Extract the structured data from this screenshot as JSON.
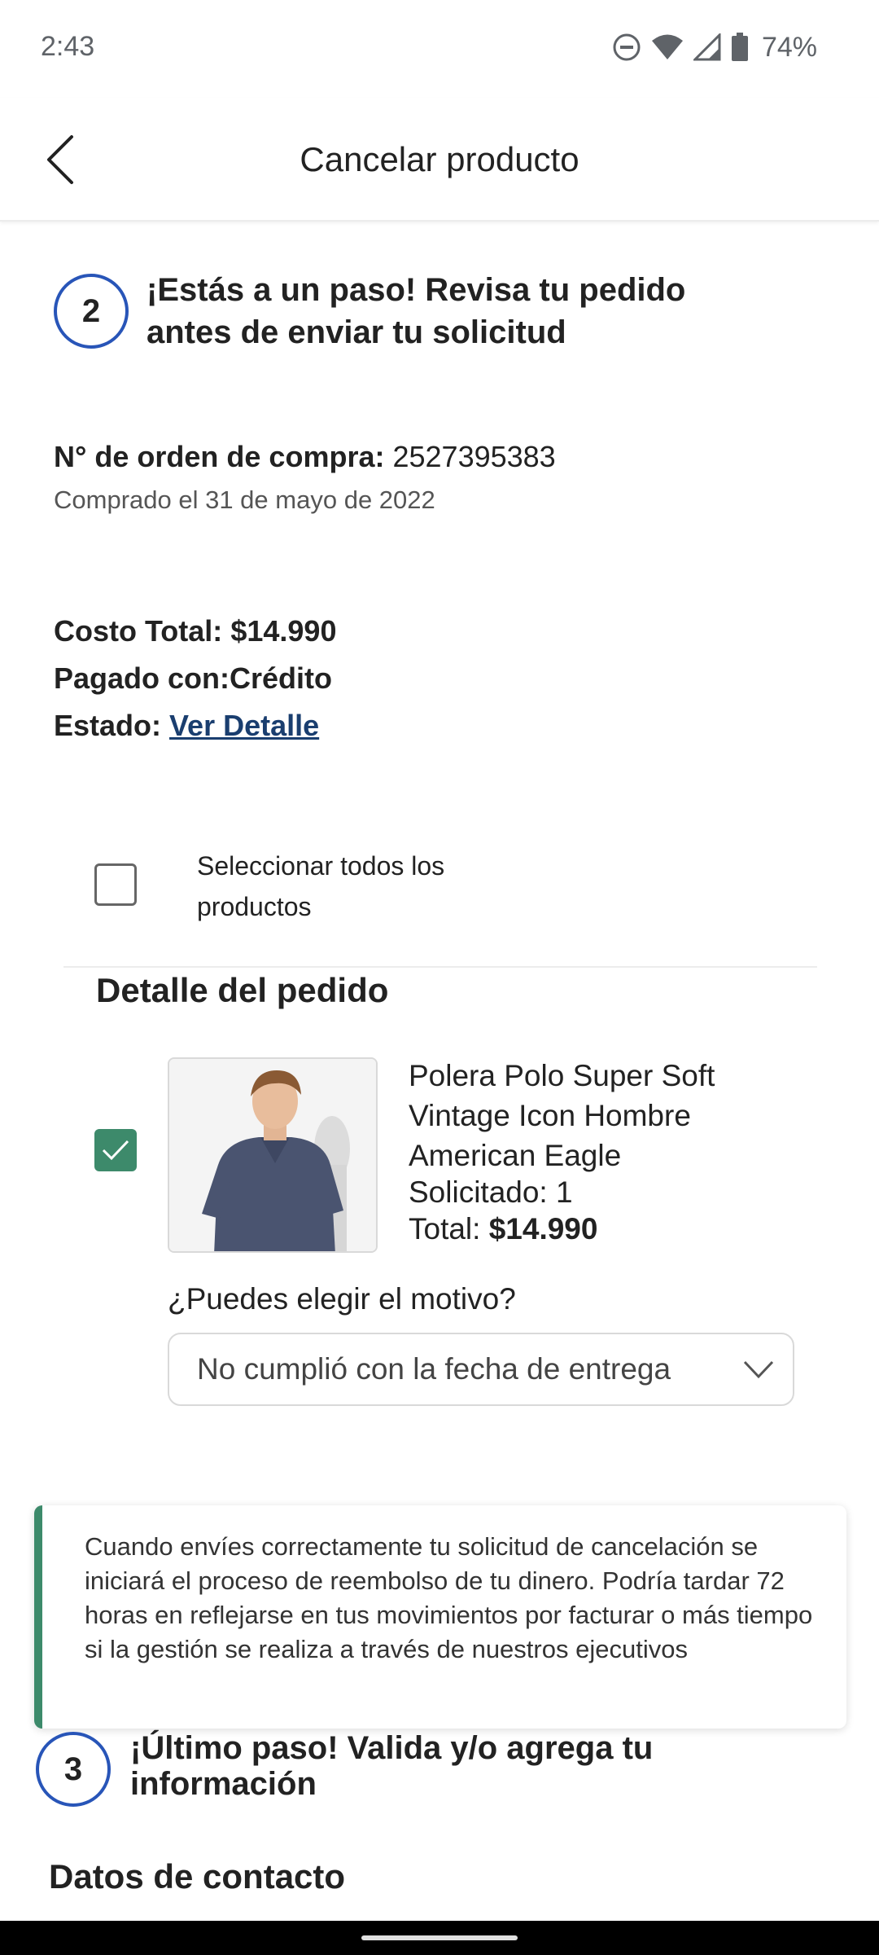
{
  "status_bar": {
    "time": "2:43",
    "battery_percent": "74%",
    "icons": [
      "do-not-disturb-icon",
      "wifi-icon",
      "signal-icon",
      "battery-icon"
    ]
  },
  "header": {
    "title": "Cancelar producto",
    "back_icon": "chevron-left-icon"
  },
  "step2": {
    "number": "2",
    "title_line1": "¡Estás a un paso! Revisa tu pedido",
    "title_line2": "antes de enviar tu solicitud"
  },
  "order": {
    "number_label": "N° de orden de compra:",
    "number_value": "2527395383",
    "purchase_date": "Comprado el 31 de mayo de 2022",
    "total_label": "Costo Total:",
    "total_value": "$14.990",
    "paid_label": "Pagado con:",
    "paid_value": "Crédito",
    "status_label": "Estado:",
    "status_link": "Ver Detalle"
  },
  "select_all": {
    "label": "Seleccionar todos los productos",
    "checked": false
  },
  "order_detail": {
    "title": "Detalle del pedido",
    "product": {
      "checked": true,
      "name_line1": "Polera Polo Super Soft",
      "name_line2": "Vintage Icon Hombre",
      "name_line3": "American Eagle",
      "requested": "Solicitado: 1",
      "total_label": "Total:",
      "total_value": "$14.990"
    },
    "reason_label": "¿Puedes elegir el motivo?",
    "reason_selected": "No cumplió con la fecha de entrega"
  },
  "info_box": {
    "text": "Cuando envíes correctamente tu solicitud de cancelación se iniciará el proceso de reembolso de tu dinero. Podría tardar 72 horas en reflejarse en tus movimientos por facturar o más tiempo si la gestión se realiza a través de nuestros ejecutivos"
  },
  "step3": {
    "number": "3",
    "title_line1": "¡Último paso! Valida y/o agrega tu",
    "title_line2": "información"
  },
  "contact": {
    "title": "Datos de contacto"
  },
  "colors": {
    "step_circle_border": "#2855b8",
    "accent_green": "#3d8a6b",
    "link": "#1a3e6f"
  }
}
